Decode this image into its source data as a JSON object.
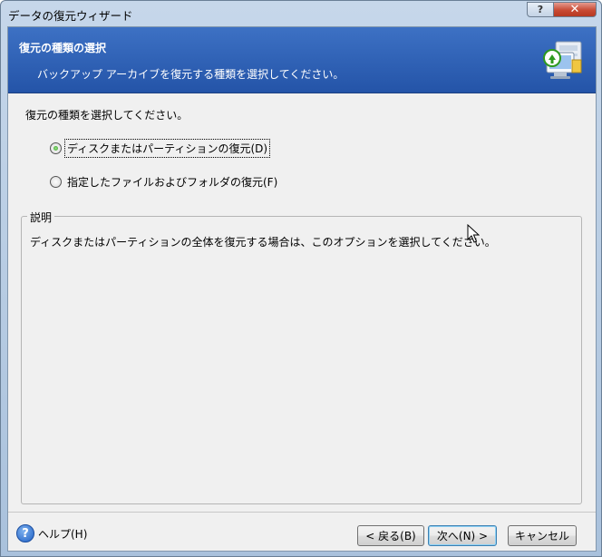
{
  "window": {
    "title": "データの復元ウィザード",
    "help_glyph": "?",
    "close_glyph": "✕"
  },
  "header": {
    "title": "復元の種類の選択",
    "subtitle": "バックアップ アーカイブを復元する種類を選択してください。",
    "icon": "restore-computer-icon"
  },
  "main": {
    "prompt": "復元の種類を選択してください。",
    "options": [
      {
        "label": "ディスクまたはパーティションの復元(D)",
        "checked": true
      },
      {
        "label": "指定したファイルおよびフォルダの復元(F)",
        "checked": false
      }
    ],
    "description": {
      "legend": "説明",
      "text": "ディスクまたはパーティションの全体を復元する場合は、このオプションを選択してください。"
    }
  },
  "footer": {
    "help_label": "ヘルプ(H)",
    "help_glyph": "?",
    "back_label": "< 戻る(B)",
    "next_label": "次へ(N) >",
    "cancel_label": "キャンセル"
  },
  "colors": {
    "header_bg": "#2b5cb0",
    "radio_checked": "#2e9a1e",
    "close_button": "#c84a34"
  }
}
